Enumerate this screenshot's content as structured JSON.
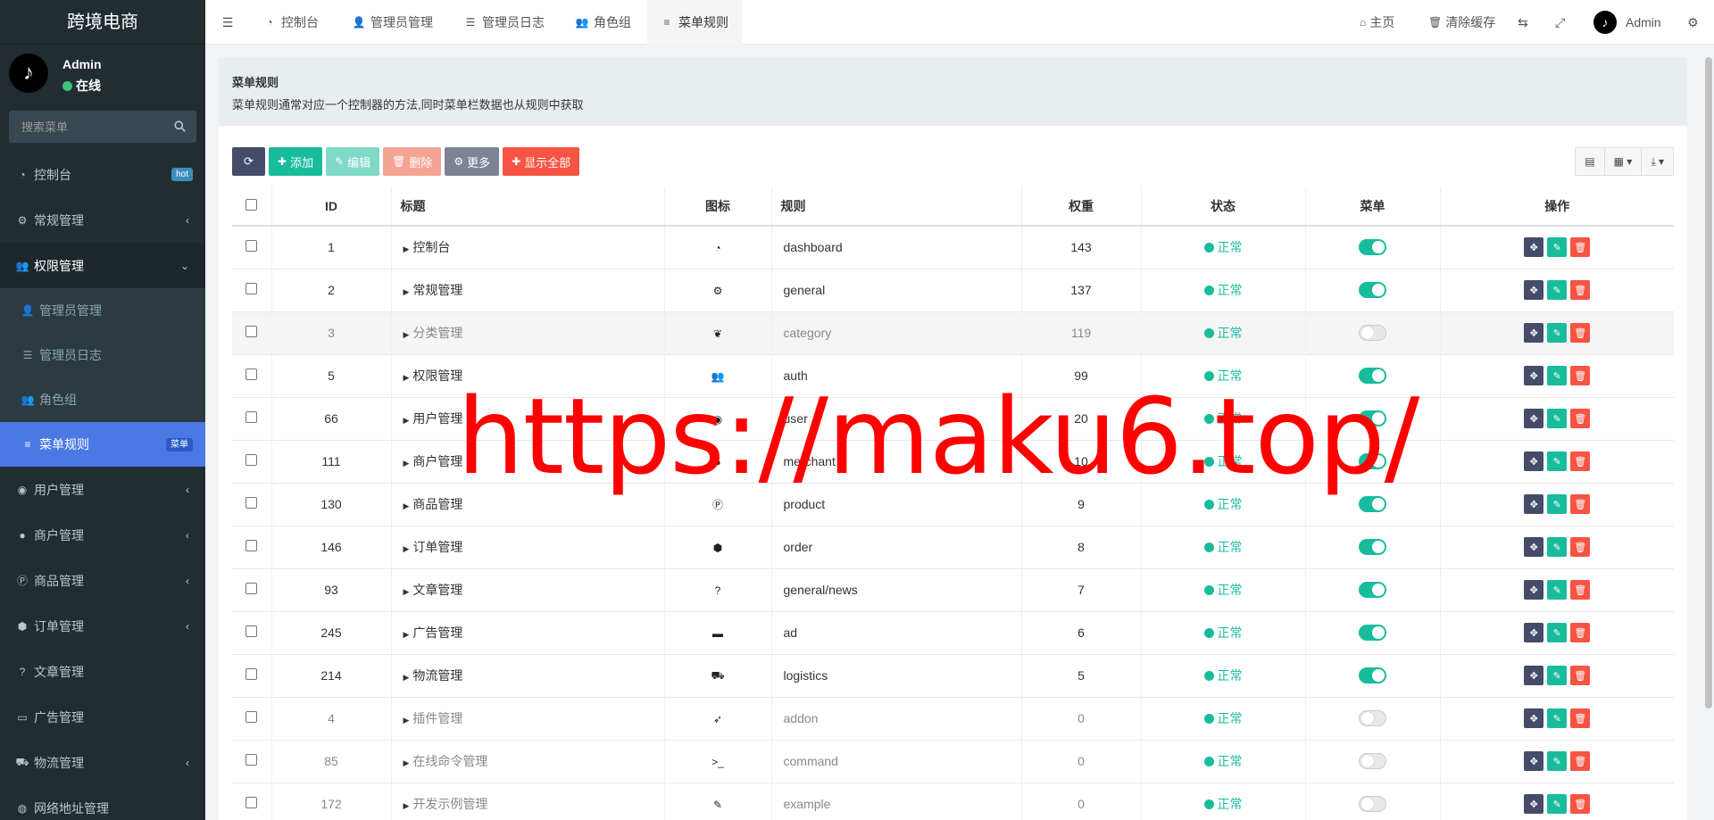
{
  "sidebar": {
    "logo": "跨境电商",
    "user": {
      "name": "Admin",
      "status": "在线"
    },
    "search_placeholder": "搜索菜单",
    "items": [
      {
        "label": "控制台",
        "icon": "dashboard-icon",
        "badge": "hot"
      },
      {
        "label": "常规管理",
        "icon": "cogs-icon"
      },
      {
        "label": "权限管理",
        "icon": "users-icon",
        "open": true
      },
      {
        "label": "用户管理",
        "icon": "user-circle-icon"
      },
      {
        "label": "商户管理",
        "icon": "apple-icon"
      },
      {
        "label": "商品管理",
        "icon": "product-icon"
      },
      {
        "label": "订单管理",
        "icon": "cube-icon"
      },
      {
        "label": "文章管理",
        "icon": "question-icon"
      },
      {
        "label": "广告管理",
        "icon": "card-icon"
      },
      {
        "label": "物流管理",
        "icon": "truck-icon"
      },
      {
        "label": "网络地址管理",
        "icon": "globe-icon"
      }
    ],
    "subitems": [
      {
        "label": "管理员管理",
        "icon": "user-icon"
      },
      {
        "label": "管理员日志",
        "icon": "list-icon"
      },
      {
        "label": "角色组",
        "icon": "group-icon"
      },
      {
        "label": "菜单规则",
        "icon": "bars-icon",
        "badge": "菜单",
        "active": true
      }
    ]
  },
  "topbar": {
    "tabs": [
      "控制台",
      "管理员管理",
      "管理员日志",
      "角色组",
      "菜单规则"
    ],
    "home": "主页",
    "clear_cache": "清除缓存",
    "admin": "Admin"
  },
  "page": {
    "title": "菜单规则",
    "desc": "菜单规则通常对应一个控制器的方法,同时菜单栏数据也从规则中获取"
  },
  "toolbar": {
    "add": "添加",
    "edit": "编辑",
    "delete": "删除",
    "more": "更多",
    "show_all": "显示全部"
  },
  "table": {
    "headers": [
      "ID",
      "标题",
      "图标",
      "规则",
      "权重",
      "状态",
      "菜单",
      "操作"
    ],
    "status_label": "正常",
    "rows": [
      {
        "id": "1",
        "title": "控制台",
        "icon": "dashboard-icon",
        "rule": "dashboard",
        "weigh": "143",
        "menu": true
      },
      {
        "id": "2",
        "title": "常规管理",
        "icon": "cogs-icon",
        "rule": "general",
        "weigh": "137",
        "menu": true
      },
      {
        "id": "3",
        "title": "分类管理",
        "icon": "leaf-icon",
        "rule": "category",
        "weigh": "119",
        "menu": false
      },
      {
        "id": "5",
        "title": "权限管理",
        "icon": "users-icon",
        "rule": "auth",
        "weigh": "99",
        "menu": true
      },
      {
        "id": "66",
        "title": "用户管理",
        "icon": "user-circle-icon",
        "rule": "user",
        "weigh": "20",
        "menu": true
      },
      {
        "id": "111",
        "title": "商户管理",
        "icon": "apple-icon",
        "rule": "merchant",
        "weigh": "10",
        "menu": true
      },
      {
        "id": "130",
        "title": "商品管理",
        "icon": "product-icon",
        "rule": "product",
        "weigh": "9",
        "menu": true
      },
      {
        "id": "146",
        "title": "订单管理",
        "icon": "cube-icon",
        "rule": "order",
        "weigh": "8",
        "menu": true
      },
      {
        "id": "93",
        "title": "文章管理",
        "icon": "question-icon",
        "rule": "general/news",
        "weigh": "7",
        "menu": true
      },
      {
        "id": "245",
        "title": "广告管理",
        "icon": "card-icon",
        "rule": "ad",
        "weigh": "6",
        "menu": true
      },
      {
        "id": "214",
        "title": "物流管理",
        "icon": "truck-icon",
        "rule": "logistics",
        "weigh": "5",
        "menu": true
      },
      {
        "id": "4",
        "title": "插件管理",
        "icon": "rocket-icon",
        "rule": "addon",
        "weigh": "0",
        "menu": false
      },
      {
        "id": "85",
        "title": "在线命令管理",
        "icon": "terminal-icon",
        "rule": "command",
        "weigh": "0",
        "menu": false
      },
      {
        "id": "172",
        "title": "开发示例管理",
        "icon": "magic-icon",
        "rule": "example",
        "weigh": "0",
        "menu": false
      }
    ]
  },
  "watermark": "https://maku6.top/"
}
